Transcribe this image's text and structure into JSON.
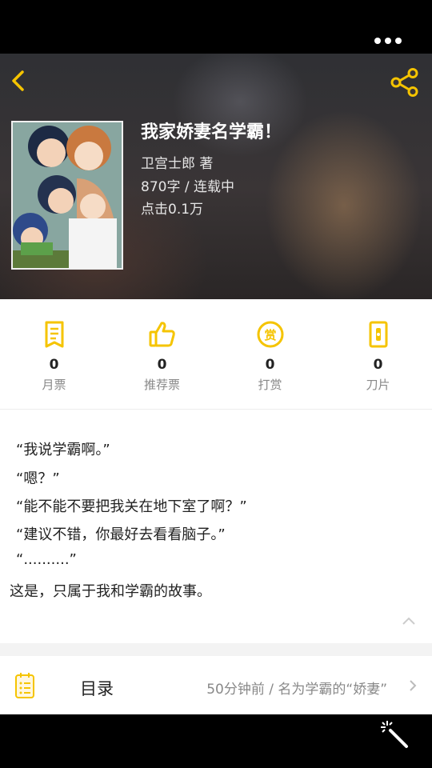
{
  "book": {
    "title": "我家娇妻名学霸！",
    "author_line": "卫宫士郎  著",
    "words_status": "870字 / 连载中",
    "clicks": "点击0.1万"
  },
  "stats": [
    {
      "label": "月票",
      "count": "0",
      "icon": "monthly-ticket-icon"
    },
    {
      "label": "推荐票",
      "count": "0",
      "icon": "thumbs-up-icon"
    },
    {
      "label": "打赏",
      "count": "0",
      "icon": "reward-icon"
    },
    {
      "label": "刀片",
      "count": "0",
      "icon": "blade-icon"
    }
  ],
  "intro": [
    "“我说学霸啊。”",
    "“嗯？”",
    "“能不能不要把我关在地下室了啊？”",
    "“建议不错，你最好去看看脑子。”",
    "“..........”",
    "这是，只属于我和学霸的故事。"
  ],
  "toc": {
    "label": "目录",
    "latest": "50分钟前 / 名为学霸的“娇妻”"
  },
  "colors": {
    "accent": "#f5c400",
    "text": "#222222",
    "muted": "#888888"
  }
}
